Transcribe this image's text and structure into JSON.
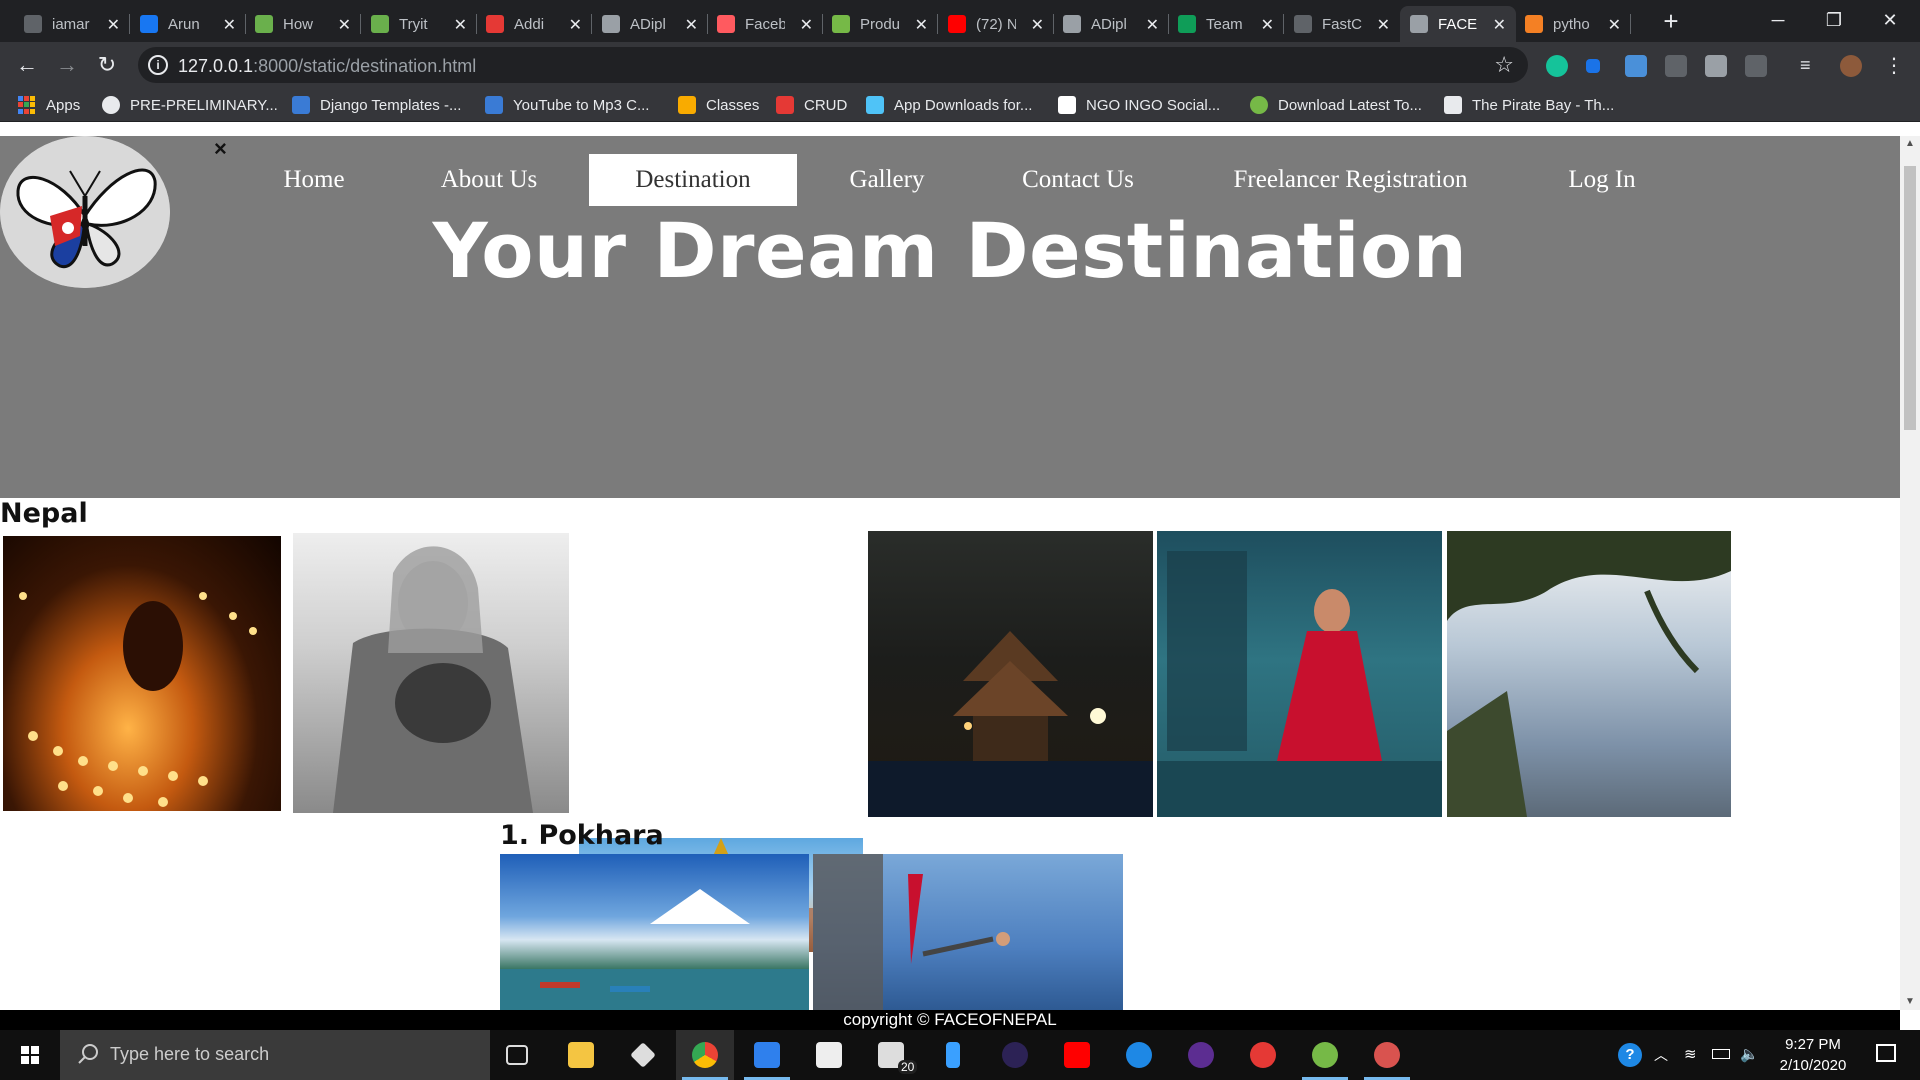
{
  "browser": {
    "tabs": [
      {
        "title": "iamar",
        "color": "#5f6368"
      },
      {
        "title": "Arun",
        "color": "#1877f2"
      },
      {
        "title": "How",
        "color": "#6ab04c"
      },
      {
        "title": "Tryit",
        "color": "#6ab04c"
      },
      {
        "title": "Addi",
        "color": "#e53935"
      },
      {
        "title": "ADipl",
        "color": "#9aa0a6"
      },
      {
        "title": "Faceb",
        "color": "#ff5a5f"
      },
      {
        "title": "Produ",
        "color": "#76b947"
      },
      {
        "title": "(72) N",
        "color": "#ff0000"
      },
      {
        "title": "ADipl",
        "color": "#9aa0a6"
      },
      {
        "title": "Team",
        "color": "#0f9d58"
      },
      {
        "title": "FastC",
        "color": "#5f6368"
      },
      {
        "title": "FACE",
        "color": "#9aa0a6"
      },
      {
        "title": "pytho",
        "color": "#f48024"
      }
    ],
    "url_host": "127.0.0.1",
    "url_path": ":8000/static/destination.html",
    "bookmarks": [
      {
        "label": "Apps",
        "icon": "apps-grid-icon",
        "color": "#4285f4"
      },
      {
        "label": "PRE-PRELIMINARY...",
        "icon": "globe-icon",
        "color": "#e8eaed"
      },
      {
        "label": "Django Templates -...",
        "icon": "django-icon",
        "color": "#3a7bd5"
      },
      {
        "label": "YouTube to Mp3 C...",
        "icon": "converter-icon",
        "color": "#3a7bd5"
      },
      {
        "label": "Classes",
        "icon": "classroom-icon",
        "color": "#f9ab00"
      },
      {
        "label": "CRUD",
        "icon": "crud-icon",
        "color": "#e53935"
      },
      {
        "label": "App Downloads for...",
        "icon": "download-icon",
        "color": "#4fc3f7"
      },
      {
        "label": "NGO INGO Social...",
        "icon": "ngo-icon",
        "color": "#ffffff"
      },
      {
        "label": "Download Latest To...",
        "icon": "utorrent-icon",
        "color": "#76b947"
      },
      {
        "label": "The Pirate Bay - Th...",
        "icon": "pirate-bay-icon",
        "color": "#e8eaed"
      }
    ]
  },
  "page": {
    "close_label": "×",
    "nav": [
      {
        "label": "Home",
        "active": false
      },
      {
        "label": "About Us",
        "active": false
      },
      {
        "label": "Destination",
        "active": true
      },
      {
        "label": "Gallery",
        "active": false
      },
      {
        "label": "Contact Us",
        "active": false
      },
      {
        "label": "Freelancer Registration",
        "active": false
      },
      {
        "label": "Log In",
        "active": false
      }
    ],
    "hero_title": "Your Dream Destination",
    "section_nepal": "Nepal",
    "section_pokhara": "1. Pokhara",
    "footer": "copyright © FACEOFNEPAL",
    "colors": {
      "hero_bg": "#7b7b7b",
      "footer_bg": "#000000"
    }
  },
  "taskbar": {
    "search_placeholder": "Type here to search",
    "mail_badge": "20",
    "time": "9:27 PM",
    "date": "2/10/2020"
  }
}
